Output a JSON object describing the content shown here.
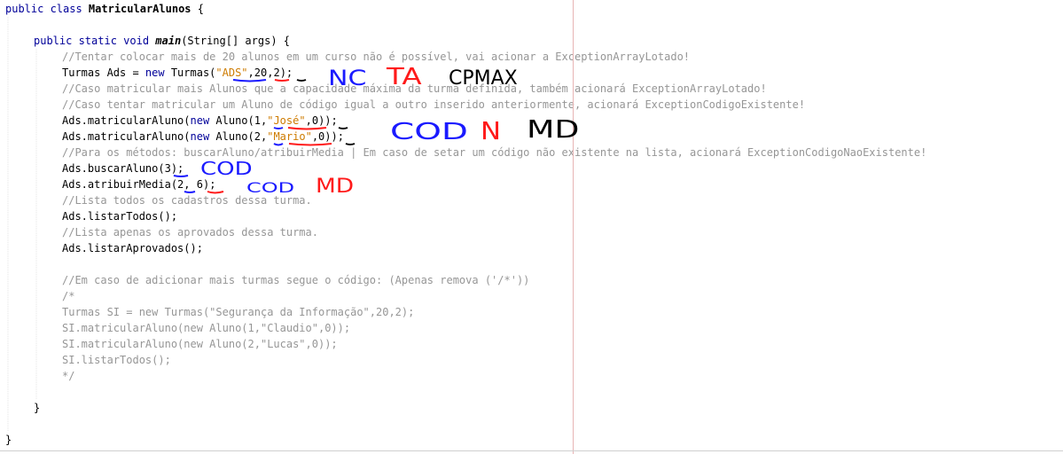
{
  "code": {
    "class_decl": {
      "kw": "public class ",
      "name": "MatricularAlunos",
      "brace": " {"
    },
    "main_decl": {
      "kw": "public static void ",
      "name": "main",
      "params": "(String[] args) {"
    },
    "comment_1": "//Tentar colocar mais de 20 alunos em um curso não é possível, vai acionar a ExceptionArrayLotado!",
    "turmas_line": {
      "prefix": "Turmas Ads = ",
      "kw_new": "new",
      "call": " Turmas(",
      "str": "\"ADS\"",
      "sep1": ",",
      "n1": "20",
      "sep2": ",",
      "n2": "2",
      "end": ");"
    },
    "comment_2": "//Caso matricular mais Alunos que a capacidade máxima da turma definida, também acionará ExceptionArrayLotado!",
    "comment_3": "//Caso tentar matricular um Aluno de código igual a outro inserido anteriormente, acionará ExceptionCodigoExistente!",
    "matric_1": {
      "prefix": "Ads.matricularAluno(",
      "kw_new": "new",
      "call": " Aluno(",
      "n1": "1",
      "sep1": ",",
      "str": "\"José\"",
      "sep2": ",",
      "n2": "0",
      "end": "));"
    },
    "matric_2": {
      "prefix": "Ads.matricularAluno(",
      "kw_new": "new",
      "call": " Aluno(",
      "n1": "2",
      "sep1": ",",
      "str": "\"Mario\"",
      "sep2": ",",
      "n2": "0",
      "end": "));"
    },
    "comment_4": "//Para os métodos: buscarAluno/atribuirMedia | Em caso de setar um código não existente na lista, acionará ExceptionCodigoNaoExistente!",
    "buscar": {
      "prefix": "Ads.buscarAluno(",
      "n1": "3",
      "end": ");"
    },
    "atribuir": {
      "prefix": "Ads.atribuirMedia(",
      "n1": "2",
      "sep1": ", ",
      "n2": "6",
      "end": ");"
    },
    "comment_5": "//Lista todos os cadastros dessa turma.",
    "listar_todos": "Ads.listarTodos();",
    "comment_6": "//Lista apenas os aprovados dessa turma.",
    "listar_aprovados": "Ads.listarAprovados();",
    "comment_7": "//Em caso de adicionar mais turmas segue o código: (Apenas remova ('/*'))",
    "block_open": "/*",
    "block_1": "Turmas SI = new Turmas(\"Segurança da Informação\",20,2);",
    "block_2": "SI.matricularAluno(new Aluno(1,\"Claudio\",0));",
    "block_3": "SI.matricularAluno(new Aluno(2,\"Lucas\",0));",
    "block_4": "SI.listarTodos();",
    "block_close": "*/",
    "close_main": "}",
    "close_class": "}"
  },
  "annotations": {
    "nc": "NC",
    "ta": "TA",
    "cpmax": "CPMAX",
    "cod_1": "COD",
    "n": "N",
    "md_1": "MD",
    "cod_2": "COD",
    "cod_3": "COD",
    "md_2": "MD"
  },
  "colors": {
    "keyword": "#000099",
    "comment": "#969696",
    "string": "#ce7b00",
    "annotation_blue": "#1a1aff",
    "annotation_red": "#ff1a1a"
  }
}
